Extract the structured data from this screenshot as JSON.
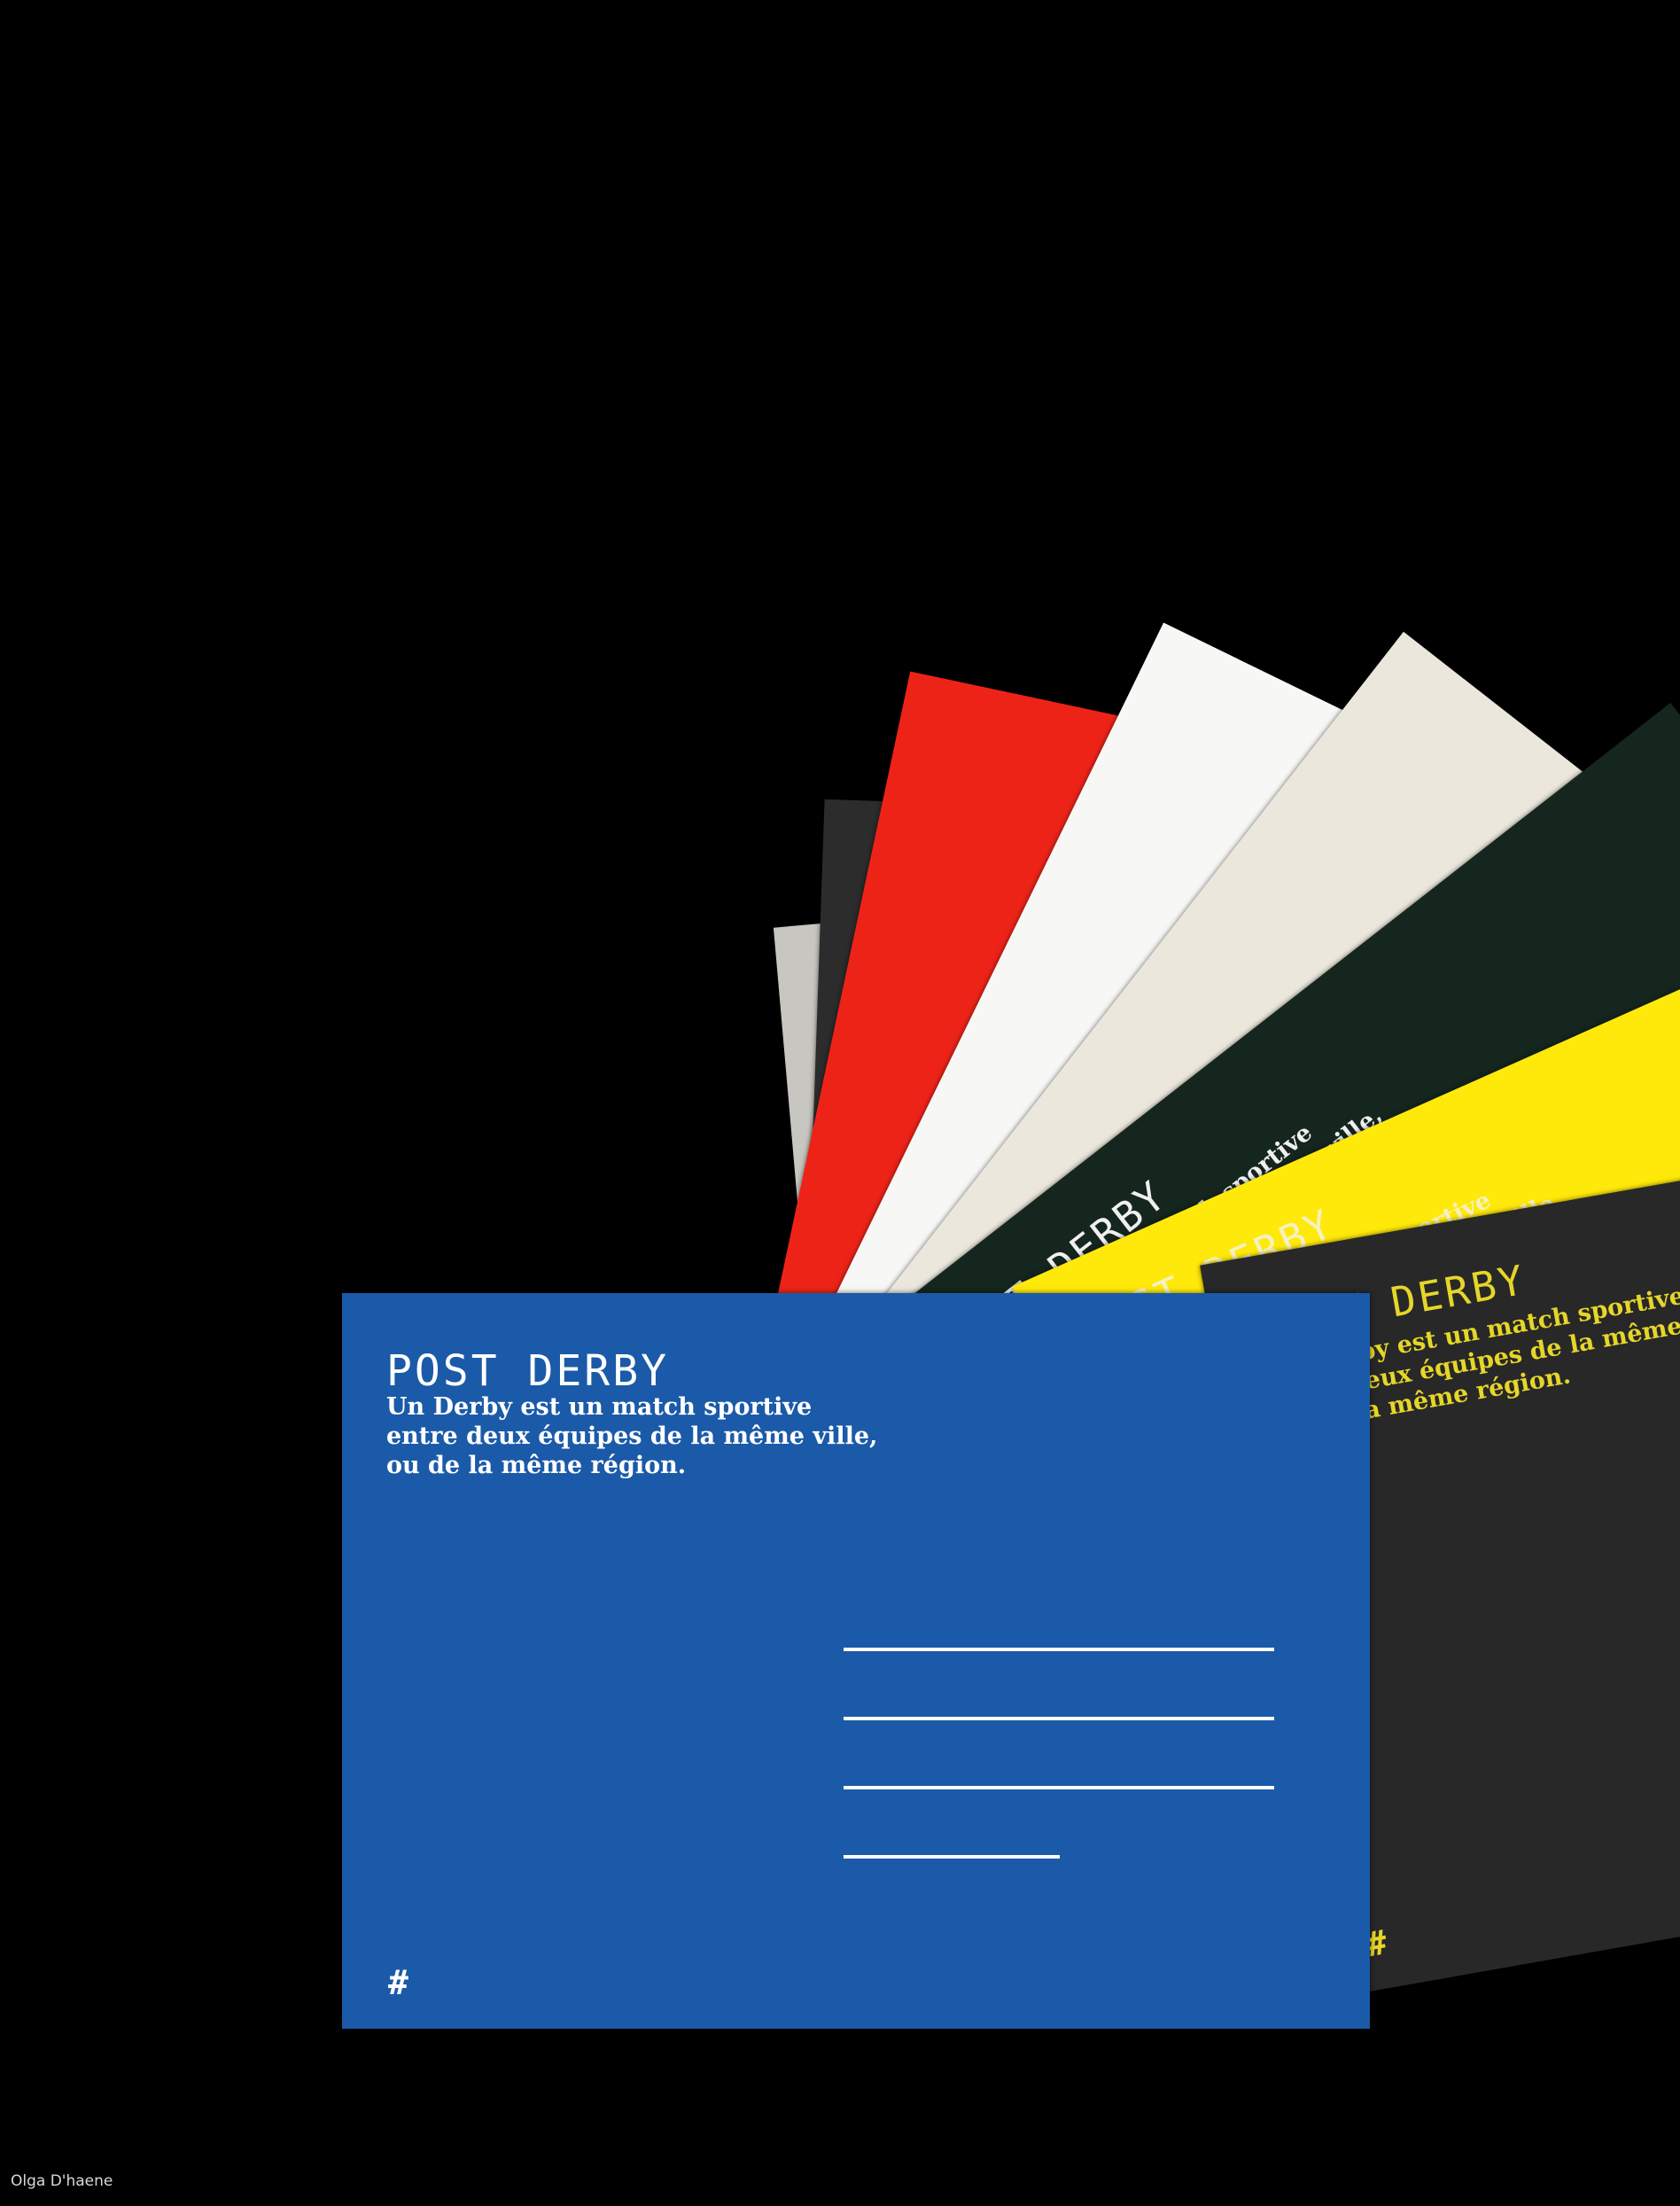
{
  "image": {
    "subject": "fan of nine postcards",
    "background": "#000000"
  },
  "card_text": {
    "title": "POST DERBY",
    "line1": "Un Derby est un match sportive",
    "line2": "entre deux équipes de la même ville,",
    "line3": "ou de la même région.",
    "hash": "#"
  },
  "cards": [
    {
      "name": "grey-card",
      "bg": "#c8c6c0",
      "text": "#d83b30",
      "hash": "#d83b30"
    },
    {
      "name": "charcoal-card-back",
      "bg": "#2c2c2c",
      "text": "#d8d8d8",
      "hash": "#d8d8d8"
    },
    {
      "name": "red-card",
      "bg": "#ee2318",
      "text": "#ffffff",
      "hash": "#ffffff"
    },
    {
      "name": "white-card",
      "bg": "#f7f7f5",
      "text": "#1f5aa6",
      "hash": "#1f5aa6"
    },
    {
      "name": "cream-card",
      "bg": "#ece7dc",
      "text": "#f2d81c",
      "hash": "#f2d81c"
    },
    {
      "name": "dark-green-card",
      "bg": "#15261e",
      "text": "#f0f0f0",
      "hash": "#d8d8d8"
    },
    {
      "name": "yellow-card",
      "bg": "#ffe90a",
      "text": "#f6f2c0",
      "hash": "#f6f2c0"
    },
    {
      "name": "charcoal-card",
      "bg": "#282828",
      "text": "#e6d628",
      "hash": "#e6d628"
    },
    {
      "name": "blue-card",
      "bg": "#1b5aa8",
      "text": "#ffffff",
      "hash": "#ffffff"
    }
  ],
  "credit": "Olga D'haene"
}
